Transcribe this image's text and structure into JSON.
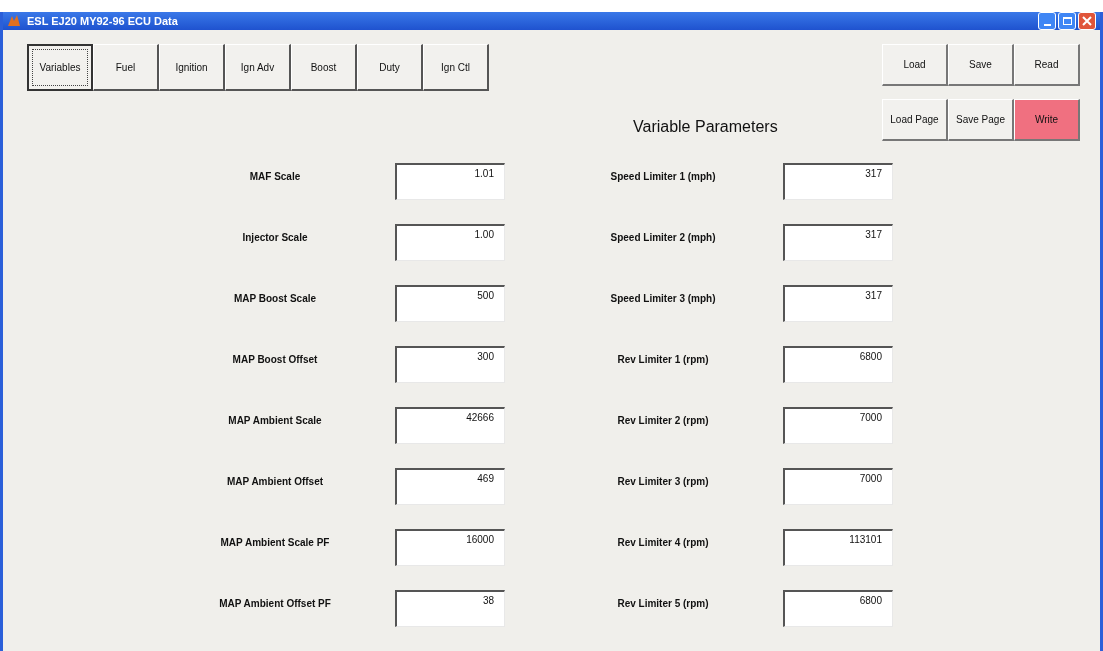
{
  "window": {
    "title": "ESL EJ20 MY92-96 ECU Data"
  },
  "tabs": [
    {
      "label": "Variables",
      "selected": true
    },
    {
      "label": "Fuel",
      "selected": false
    },
    {
      "label": "Ignition",
      "selected": false
    },
    {
      "label": "Ign Adv",
      "selected": false
    },
    {
      "label": "Boost",
      "selected": false
    },
    {
      "label": "Duty",
      "selected": false
    },
    {
      "label": "Ign Ctl",
      "selected": false
    }
  ],
  "buttons": [
    {
      "label": "Load",
      "highlighted": false
    },
    {
      "label": "Save",
      "highlighted": false
    },
    {
      "label": "Read",
      "highlighted": false
    },
    {
      "label": "Load Page",
      "highlighted": false
    },
    {
      "label": "Save Page",
      "highlighted": false
    },
    {
      "label": "Write",
      "highlighted": true
    }
  ],
  "heading": "Variable Parameters",
  "left_params": [
    {
      "label": "MAF Scale",
      "value": "1.01"
    },
    {
      "label": "Injector Scale",
      "value": "1.00"
    },
    {
      "label": "MAP Boost Scale",
      "value": "500"
    },
    {
      "label": "MAP Boost Offset",
      "value": "300"
    },
    {
      "label": "MAP Ambient Scale",
      "value": "42666"
    },
    {
      "label": "MAP Ambient Offset",
      "value": "469"
    },
    {
      "label": "MAP Ambient Scale PF",
      "value": "16000"
    },
    {
      "label": "MAP Ambient Offset PF",
      "value": "38"
    }
  ],
  "right_params": [
    {
      "label": "Speed Limiter 1 (mph)",
      "value": "317"
    },
    {
      "label": "Speed Limiter 2 (mph)",
      "value": "317"
    },
    {
      "label": "Speed Limiter 3 (mph)",
      "value": "317"
    },
    {
      "label": "Rev Limiter 1 (rpm)",
      "value": "6800"
    },
    {
      "label": "Rev Limiter 2 (rpm)",
      "value": "7000"
    },
    {
      "label": "Rev Limiter 3 (rpm)",
      "value": "7000"
    },
    {
      "label": "Rev Limiter 4 (rpm)",
      "value": "113101"
    },
    {
      "label": "Rev Limiter 5 (rpm)",
      "value": "6800"
    }
  ]
}
